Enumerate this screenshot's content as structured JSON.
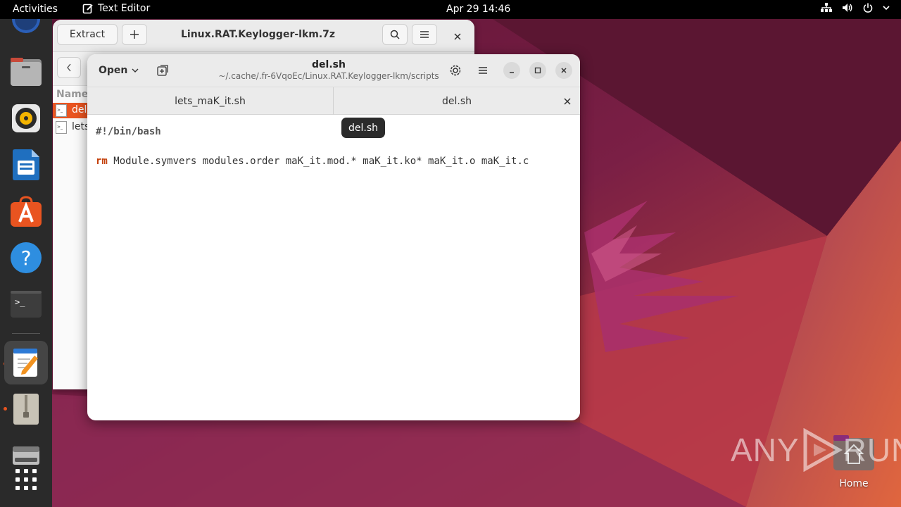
{
  "topbar": {
    "activities": "Activities",
    "app_name": "Text Editor",
    "clock": "Apr 29  14:46"
  },
  "dock": {
    "items": [
      "firefox-icon",
      "files-icon",
      "rhythmbox-icon",
      "libreoffice-writer-icon",
      "app-center-icon",
      "help-icon",
      "terminal-icon",
      "text-editor-icon",
      "archive-manager-icon",
      "disk-drive-icon",
      "show-apps-icon"
    ]
  },
  "archive_window": {
    "extract_label": "Extract",
    "title": "Linux.RAT.Keylogger-lkm.7z",
    "column_name": "Name",
    "files": [
      "del",
      "lets"
    ]
  },
  "editor_window": {
    "open_label": "Open",
    "title": "del.sh",
    "subtitle": "~/.cache/.fr-6VqoEc/Linux.RAT.Keylogger-lkm/scripts",
    "tabs": [
      {
        "label": "lets_maK_it.sh",
        "active": false
      },
      {
        "label": "del.sh",
        "active": true
      }
    ],
    "code": {
      "line1": "#!/bin/bash",
      "line3_cmd": "rm",
      "line3_args": " Module.symvers modules.order maK_it.mod.* maK_it.ko* maK_it.o maK_it.c"
    }
  },
  "tooltip": "del.sh",
  "desktop": {
    "home_label": "Home"
  },
  "watermark": {
    "left": "ANY",
    "right": "RUN"
  },
  "colors": {
    "accent": "#e95420",
    "topbar": "#000000",
    "dock": "#2a2a2a"
  }
}
